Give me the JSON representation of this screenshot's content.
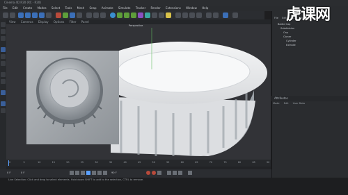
{
  "app": {
    "title": "Cinema 4D R20 (RC - R20)",
    "menu": [
      "File",
      "Edit",
      "Create",
      "Modes",
      "Select",
      "Tools",
      "Mesh",
      "Snap",
      "Animate",
      "Simulate",
      "Tracker",
      "Render",
      "Extensions",
      "Window",
      "Help"
    ],
    "layout_tabs": [
      "Startup",
      "Animate",
      "BP - UV Edit",
      "BP - 3D Paint",
      "Model",
      "Motion Tracker",
      "Nodes",
      "Sculpt",
      "UV Edit"
    ],
    "active_tab": "Startup"
  },
  "viewport": {
    "header_items": [
      "View",
      "Cameras",
      "Display",
      "Options",
      "Filter",
      "Panel"
    ],
    "camera_label": "Perspective"
  },
  "object_manager": {
    "header_items": [
      "File",
      "Edit",
      "View",
      "Objects",
      "Tags",
      "Bookmarks"
    ],
    "objects": [
      "Bottle Cap",
      "Subdivision",
      "Cap",
      "Cloner",
      "Cylinder",
      "Extrude"
    ]
  },
  "attribute_manager": {
    "header": "Attributes",
    "items": [
      "Mode",
      "Edit",
      "User Data"
    ]
  },
  "timeline": {
    "start_frame": "0 F",
    "end_frame": "90 F",
    "current_frame": "0 F",
    "ticks": [
      "0",
      "5",
      "10",
      "15",
      "20",
      "25",
      "30",
      "35",
      "40",
      "45",
      "50",
      "55",
      "60",
      "65",
      "70",
      "75",
      "80",
      "85",
      "90"
    ]
  },
  "status": {
    "text": "Live Selection: Click and drag to select elements. Hold down SHIFT to add to the selection, CTRL to remove."
  },
  "watermark": {
    "text": "虎课网"
  },
  "colors": {
    "accent": "#5aa0ff",
    "panel": "#2a2c2f",
    "viewport": "#323337"
  }
}
